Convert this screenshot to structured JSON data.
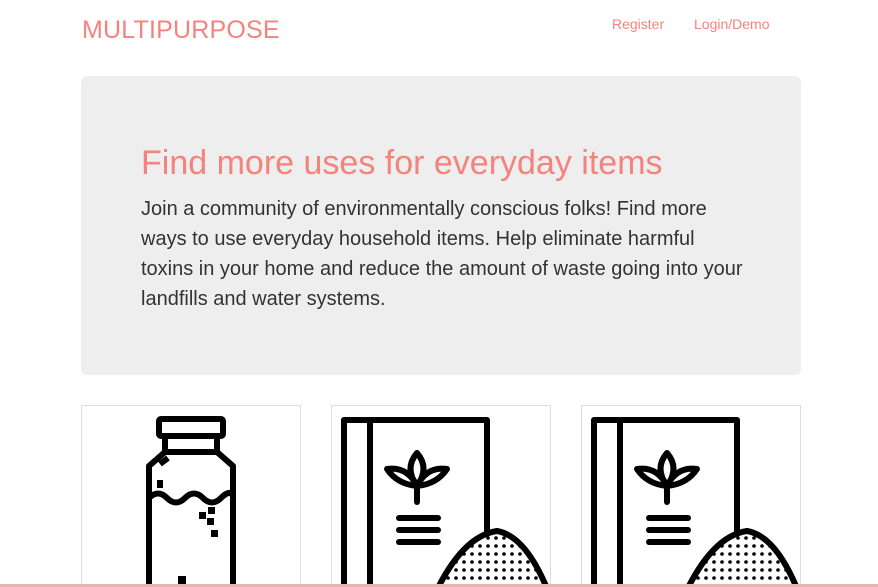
{
  "nav": {
    "brand": "MULTIPURPOSE",
    "register": "Register",
    "login": "Login/Demo"
  },
  "hero": {
    "title": "Find more uses for everyday items",
    "text": "Join a community of environmentally conscious folks! Find more ways to use everyday household items. Help eliminate harmful toxins in your home and reduce the amount of waste going into your landfills and water systems."
  },
  "cards": [
    {
      "icon": "bottle-icon"
    },
    {
      "icon": "seed-bag-icon"
    },
    {
      "icon": "seed-bag-icon"
    }
  ],
  "colors": {
    "accent": "#f4837d",
    "jumbotron_bg": "#eeeeee",
    "body_text": "#333333"
  }
}
